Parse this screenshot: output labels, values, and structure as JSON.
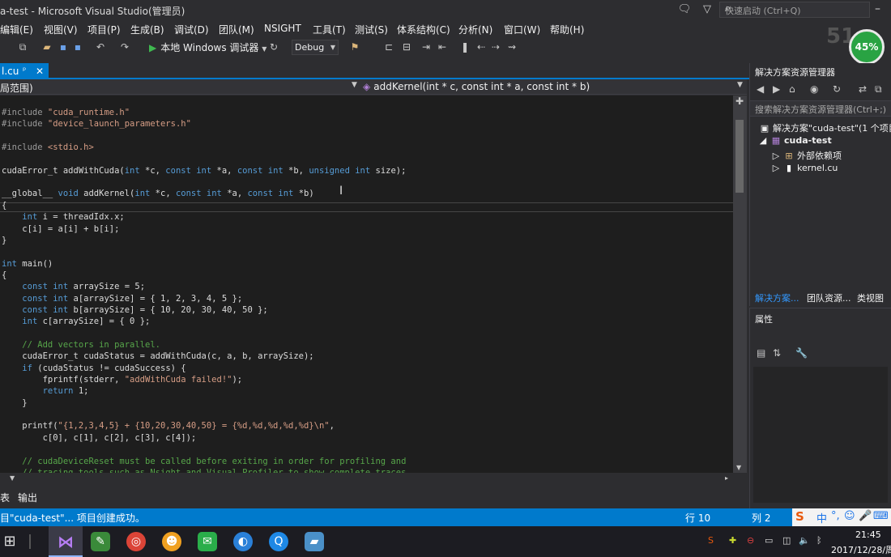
{
  "window": {
    "title": "a-test - Microsoft Visual Studio(管理员)"
  },
  "quick_launch": {
    "placeholder": "快速启动 (Ctrl+Q)"
  },
  "menu": [
    "编辑(E)",
    "视图(V)",
    "项目(P)",
    "生成(B)",
    "调试(D)",
    "团队(M)",
    "NSIGHT",
    "工具(T)",
    "测试(S)",
    "体系结构(C)",
    "分析(N)",
    "窗口(W)",
    "帮助(H)"
  ],
  "toolbar": {
    "run_label": "本地 Windows 调试器",
    "config": "Debug"
  },
  "cpu_badge": "45%",
  "watermark": "51",
  "tab": {
    "label": "l.cu",
    "pin": "ᵖ",
    "close": "✕"
  },
  "navbar": {
    "scope": "局范围)",
    "function": "addKernel(int * c, const int * a, const int * b)"
  },
  "solution_explorer": {
    "title": "解决方案资源管理器",
    "search_placeholder": "搜索解决方案资源管理器(Ctrl+;)",
    "solution": "解决方案\"cuda-test\"(1 个项目",
    "project": "cuda-test",
    "items": [
      "外部依赖项",
      "kernel.cu"
    ],
    "tabs": [
      "解决方案...",
      "团队资源...",
      "类视图"
    ]
  },
  "properties": {
    "title": "属性"
  },
  "bottom_tabs": [
    "表",
    "输出"
  ],
  "status": {
    "message": "目\"cuda-test\"... 项目创建成功。",
    "line": "行 10",
    "col": "列 2"
  },
  "ime": [
    "S",
    "中",
    "°,",
    "☺",
    "🎤",
    "⌨"
  ],
  "clock": {
    "time": "21:45",
    "date": "2017/12/28/周"
  },
  "code_lines": [
    [
      {
        "t": "#include ",
        "c": "pp"
      },
      {
        "t": "\"cuda_runtime.h\"",
        "c": "str"
      }
    ],
    [
      {
        "t": "#include ",
        "c": "pp"
      },
      {
        "t": "\"device_launch_parameters.h\"",
        "c": "str"
      }
    ],
    [],
    [
      {
        "t": "#include ",
        "c": "pp"
      },
      {
        "t": "<stdio.h>",
        "c": "str"
      }
    ],
    [],
    [
      {
        "t": "cudaError_t addWithCuda(",
        "c": ""
      },
      {
        "t": "int",
        "c": "kw"
      },
      {
        "t": " *c, ",
        "c": ""
      },
      {
        "t": "const int",
        "c": "kw"
      },
      {
        "t": " *a, ",
        "c": ""
      },
      {
        "t": "const int",
        "c": "kw"
      },
      {
        "t": " *b, ",
        "c": ""
      },
      {
        "t": "unsigned int",
        "c": "kw"
      },
      {
        "t": " size);",
        "c": ""
      }
    ],
    [],
    [
      {
        "t": "__global__ ",
        "c": ""
      },
      {
        "t": "void",
        "c": "kw"
      },
      {
        "t": " addKernel(",
        "c": ""
      },
      {
        "t": "int",
        "c": "kw"
      },
      {
        "t": " *c, ",
        "c": ""
      },
      {
        "t": "const int",
        "c": "kw"
      },
      {
        "t": " *a, ",
        "c": ""
      },
      {
        "t": "const int",
        "c": "kw"
      },
      {
        "t": " *b)",
        "c": ""
      }
    ],
    [
      {
        "t": "{",
        "c": ""
      }
    ],
    [
      {
        "t": "    ",
        "c": ""
      },
      {
        "t": "int",
        "c": "kw"
      },
      {
        "t": " i = threadIdx.x;",
        "c": ""
      }
    ],
    [
      {
        "t": "    c[i] = a[i] + b[i];",
        "c": ""
      }
    ],
    [
      {
        "t": "}",
        "c": ""
      }
    ],
    [],
    [
      {
        "t": "int",
        "c": "kw"
      },
      {
        "t": " main()",
        "c": ""
      }
    ],
    [
      {
        "t": "{",
        "c": ""
      }
    ],
    [
      {
        "t": "    ",
        "c": ""
      },
      {
        "t": "const int",
        "c": "kw"
      },
      {
        "t": " arraySize = 5;",
        "c": ""
      }
    ],
    [
      {
        "t": "    ",
        "c": ""
      },
      {
        "t": "const int",
        "c": "kw"
      },
      {
        "t": " a[arraySize] = { 1, 2, 3, 4, 5 };",
        "c": ""
      }
    ],
    [
      {
        "t": "    ",
        "c": ""
      },
      {
        "t": "const int",
        "c": "kw"
      },
      {
        "t": " b[arraySize] = { 10, 20, 30, 40, 50 };",
        "c": ""
      }
    ],
    [
      {
        "t": "    ",
        "c": ""
      },
      {
        "t": "int",
        "c": "kw"
      },
      {
        "t": " c[arraySize] = { 0 };",
        "c": ""
      }
    ],
    [],
    [
      {
        "t": "    // Add vectors in parallel.",
        "c": "cm"
      }
    ],
    [
      {
        "t": "    cudaError_t cudaStatus = addWithCuda(c, a, b, arraySize);",
        "c": ""
      }
    ],
    [
      {
        "t": "    ",
        "c": ""
      },
      {
        "t": "if",
        "c": "kw"
      },
      {
        "t": " (cudaStatus != cudaSuccess) {",
        "c": ""
      }
    ],
    [
      {
        "t": "        fprintf(stderr, ",
        "c": ""
      },
      {
        "t": "\"addWithCuda failed!\"",
        "c": "str"
      },
      {
        "t": ");",
        "c": ""
      }
    ],
    [
      {
        "t": "        ",
        "c": ""
      },
      {
        "t": "return",
        "c": "kw"
      },
      {
        "t": " 1;",
        "c": ""
      }
    ],
    [
      {
        "t": "    }",
        "c": ""
      }
    ],
    [],
    [
      {
        "t": "    printf(",
        "c": ""
      },
      {
        "t": "\"{1,2,3,4,5} + {10,20,30,40,50} = {%d,%d,%d,%d,%d}\\n\"",
        "c": "str"
      },
      {
        "t": ",",
        "c": ""
      }
    ],
    [
      {
        "t": "        c[0], c[1], c[2], c[3], c[4]);",
        "c": ""
      }
    ],
    [],
    [
      {
        "t": "    // cudaDeviceReset must be called before exiting in order for profiling and",
        "c": "cm"
      }
    ],
    [
      {
        "t": "    // tracing tools such as Nsight and Visual Profiler to show complete traces.",
        "c": "cm"
      }
    ]
  ]
}
